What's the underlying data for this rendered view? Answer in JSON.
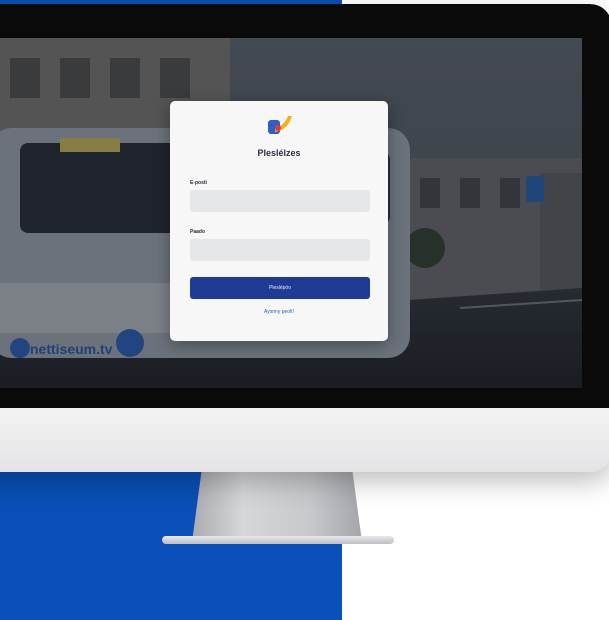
{
  "login": {
    "title": "Pleslélzes",
    "email_label": "E-posti",
    "email_value": "",
    "password_label": "Paado",
    "password_value": "",
    "submit_label": "Pleslépöo",
    "forgot_link": "Aysnny peolt!"
  },
  "background_photo": {
    "bus_text": "nettiseum.tv"
  },
  "colors": {
    "brand_blue": "#0a4fb7",
    "button_blue": "#1e3c96",
    "link_blue": "#1e5fc8",
    "logo_blue": "#2d5ec9",
    "logo_yellow": "#f2b318",
    "logo_red": "#e23b2e"
  },
  "icons": {
    "logo": "brand-logo-icon"
  }
}
